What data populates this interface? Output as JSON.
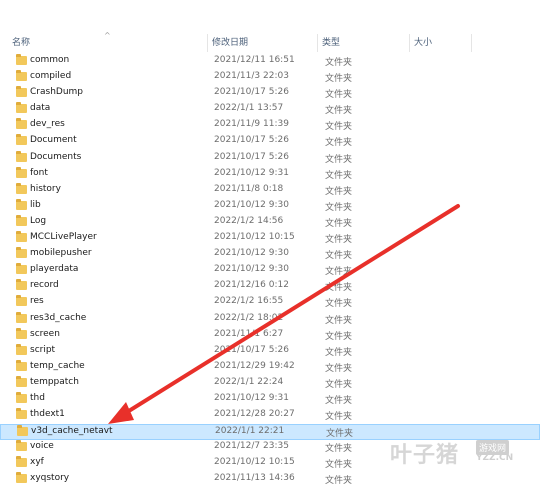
{
  "columns": {
    "name": "名称",
    "date": "修改日期",
    "type": "类型",
    "size": "大小"
  },
  "sort_indicator": "^",
  "folder_type": "文件夹",
  "files": [
    {
      "name": "common",
      "date": "2021/12/11 16:51"
    },
    {
      "name": "compiled",
      "date": "2021/11/3 22:03"
    },
    {
      "name": "CrashDump",
      "date": "2021/10/17 5:26"
    },
    {
      "name": "data",
      "date": "2022/1/1 13:57"
    },
    {
      "name": "dev_res",
      "date": "2021/11/9 11:39"
    },
    {
      "name": "Document",
      "date": "2021/10/17 5:26"
    },
    {
      "name": "Documents",
      "date": "2021/10/17 5:26"
    },
    {
      "name": "font",
      "date": "2021/10/12 9:31"
    },
    {
      "name": "history",
      "date": "2021/11/8 0:18"
    },
    {
      "name": "lib",
      "date": "2021/10/12 9:30"
    },
    {
      "name": "Log",
      "date": "2022/1/2 14:56"
    },
    {
      "name": "MCCLivePlayer",
      "date": "2021/10/12 10:15"
    },
    {
      "name": "mobilepusher",
      "date": "2021/10/12 9:30"
    },
    {
      "name": "playerdata",
      "date": "2021/10/12 9:30"
    },
    {
      "name": "record",
      "date": "2021/12/16 0:12"
    },
    {
      "name": "res",
      "date": "2022/1/2 16:55"
    },
    {
      "name": "res3d_cache",
      "date": "2022/1/2 18:02"
    },
    {
      "name": "screen",
      "date": "2021/11/1 6:27"
    },
    {
      "name": "script",
      "date": "2021/10/17 5:26"
    },
    {
      "name": "temp_cache",
      "date": "2021/12/29 19:42"
    },
    {
      "name": "temppatch",
      "date": "2022/1/1 22:24"
    },
    {
      "name": "thd",
      "date": "2021/10/12 9:31"
    },
    {
      "name": "thdext1",
      "date": "2021/12/28 20:27"
    },
    {
      "name": "v3d_cache_netavt",
      "date": "2022/1/1 22:21",
      "selected": true
    },
    {
      "name": "voice",
      "date": "2021/12/7 23:35"
    },
    {
      "name": "xyf",
      "date": "2021/10/12 10:15"
    },
    {
      "name": "xyqstory",
      "date": "2021/11/13 14:36"
    }
  ],
  "annotation": {
    "color": "#e8302a"
  },
  "watermark": {
    "big": "叶子猪",
    "box": "游戏网",
    "url": "YZZ.CN"
  },
  "icons": {
    "folder": "folder-icon",
    "sort": "sort-up-arrow-icon"
  }
}
